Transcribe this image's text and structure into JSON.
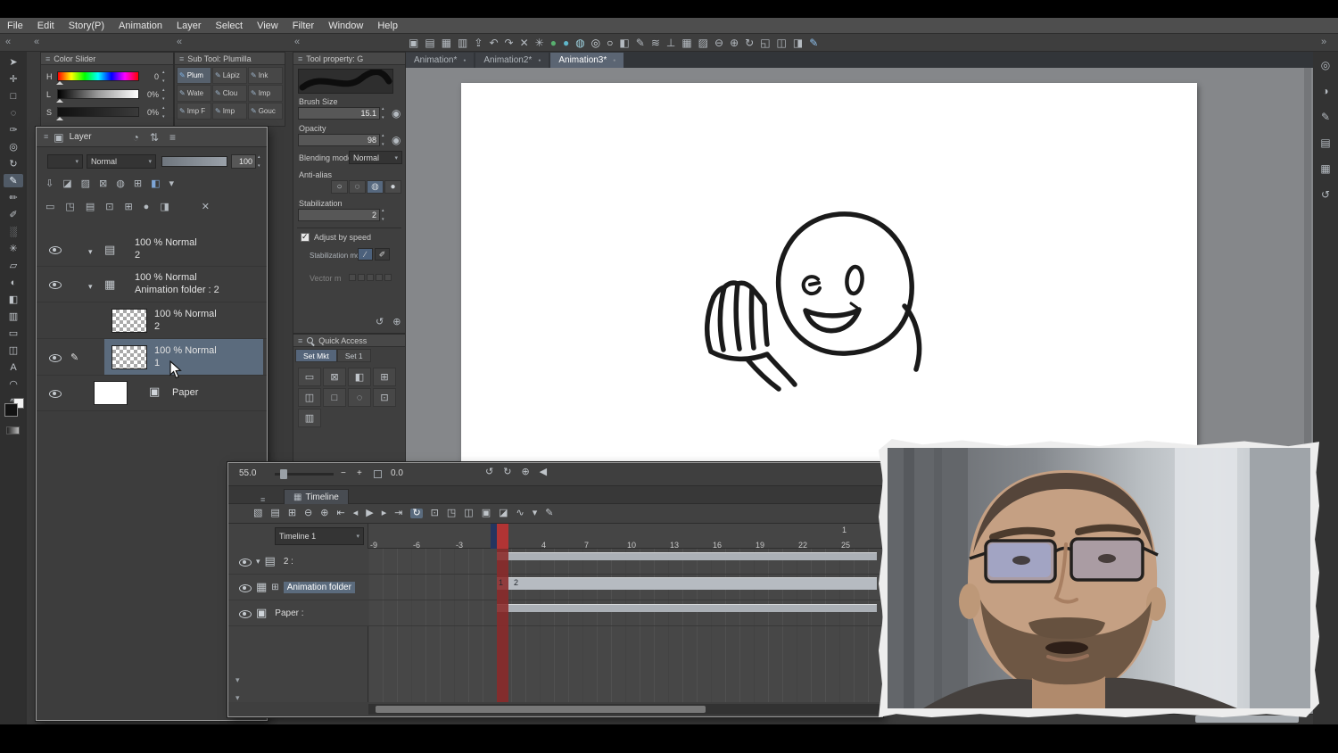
{
  "chrome": {
    "collapse_left": "«",
    "collapse_right": "»"
  },
  "menubar": {
    "items": [
      "File",
      "Edit",
      "Story(P)",
      "Animation",
      "Layer",
      "Select",
      "View",
      "Filter",
      "Window",
      "Help"
    ]
  },
  "main_toolbar": {
    "icons": [
      {
        "name": "workspace-icon",
        "glyph": "▣"
      },
      {
        "name": "open-icon",
        "glyph": "▤"
      },
      {
        "name": "save-icon",
        "glyph": "▦"
      },
      {
        "name": "print-icon",
        "glyph": "▥"
      },
      {
        "name": "export-icon",
        "glyph": "⇪"
      },
      {
        "name": "undo-icon",
        "glyph": "↶"
      },
      {
        "name": "redo-icon",
        "glyph": "↷"
      },
      {
        "name": "deselect-icon",
        "glyph": "✕"
      },
      {
        "name": "snap-icon",
        "glyph": "✳"
      },
      {
        "name": "onion-prev-icon",
        "glyph": "●",
        "color": "#58b06f"
      },
      {
        "name": "onion-next-icon",
        "glyph": "●",
        "color": "#5fb6c9"
      },
      {
        "name": "light-table-icon",
        "glyph": "◍",
        "color": "#9fd3e0"
      },
      {
        "name": "circle-state-icon",
        "glyph": "◎",
        "color": "#cfd6dc"
      },
      {
        "name": "white-circle-icon",
        "glyph": "○",
        "color": "#e8eef2"
      },
      {
        "name": "flip-view-icon",
        "glyph": "◧"
      },
      {
        "name": "pen-state-icon",
        "glyph": "✎"
      },
      {
        "name": "cloud-sync-icon",
        "glyph": "≋"
      },
      {
        "name": "snap-ruler-icon",
        "glyph": "⊥"
      },
      {
        "name": "grid-icon",
        "glyph": "▦"
      },
      {
        "name": "material-icon",
        "glyph": "▨"
      },
      {
        "name": "zoom-out-icon",
        "glyph": "⊖"
      },
      {
        "name": "zoom-in-icon",
        "glyph": "⊕"
      },
      {
        "name": "rotate-view-icon",
        "glyph": "↻"
      },
      {
        "name": "fit-view-icon",
        "glyph": "◱"
      },
      {
        "name": "layout-icon",
        "glyph": "◫"
      },
      {
        "name": "dual-pane-icon",
        "glyph": "◨"
      },
      {
        "name": "active-brush-icon",
        "glyph": "✎",
        "color": "#8fc1ee",
        "active": true
      }
    ]
  },
  "doc_tabs": [
    {
      "name": "tab-animation-1",
      "label": "Animation*"
    },
    {
      "name": "tab-animation-2",
      "label": "Animation2*"
    },
    {
      "name": "tab-animation-3",
      "label": "Animation3*",
      "active": true
    }
  ],
  "tool_strip": {
    "tools": [
      {
        "name": "operation-tool-icon",
        "glyph": "➤"
      },
      {
        "name": "move-tool-icon",
        "glyph": "✛"
      },
      {
        "name": "selection-tool-icon",
        "glyph": "□"
      },
      {
        "name": "auto-select-tool-icon",
        "glyph": "◌"
      },
      {
        "name": "eyedropper-tool-icon",
        "glyph": "✑"
      },
      {
        "name": "zoom-tool-icon",
        "glyph": "◎"
      },
      {
        "name": "rotate-tool-icon",
        "glyph": "↻"
      },
      {
        "name": "pen-tool-icon",
        "glyph": "✎",
        "active": true
      },
      {
        "name": "pencil-tool-icon",
        "glyph": "✏"
      },
      {
        "name": "brush-tool-icon",
        "glyph": "✐"
      },
      {
        "name": "airbrush-tool-icon",
        "glyph": "░"
      },
      {
        "name": "decoration-tool-icon",
        "glyph": "✳"
      },
      {
        "name": "eraser-tool-icon",
        "glyph": "▱"
      },
      {
        "name": "blend-tool-icon",
        "glyph": "◐"
      },
      {
        "name": "fill-tool-icon",
        "glyph": "◧"
      },
      {
        "name": "gradient-tool-icon",
        "glyph": "▥"
      },
      {
        "name": "figure-tool-icon",
        "glyph": "▭"
      },
      {
        "name": "frame-border-tool-icon",
        "glyph": "◫"
      },
      {
        "name": "text-tool-icon",
        "glyph": "A"
      },
      {
        "name": "balloon-tool-icon",
        "glyph": "◠"
      },
      {
        "name": "correct-line-tool-icon",
        "glyph": "∿"
      }
    ]
  },
  "panels": {
    "color_slider": {
      "title": "Color Slider",
      "rows": [
        {
          "label": "H",
          "value": "0"
        },
        {
          "label": "L",
          "value": "0%"
        },
        {
          "label": "S",
          "value": "0%"
        }
      ]
    },
    "sub_tool": {
      "title": "Sub Tool: Plumilla",
      "items": [
        {
          "name": "subtool-plumilla",
          "label": "Plum",
          "active": true
        },
        {
          "name": "subtool-lapiz",
          "label": "Lápiz"
        },
        {
          "name": "subtool-ink",
          "label": "Ink"
        },
        {
          "name": "subtool-watercolor",
          "label": "Wate"
        },
        {
          "name": "subtool-cloud",
          "label": "Clou"
        },
        {
          "name": "subtool-imp-1",
          "label": "Imp"
        },
        {
          "name": "subtool-imp-f",
          "label": "Imp F"
        },
        {
          "name": "subtool-imp-2",
          "label": "Imp"
        },
        {
          "name": "subtool-gouache",
          "label": "Gouc"
        }
      ]
    },
    "tool_property": {
      "title": "Tool property: G",
      "brush_size_label": "Brush Size",
      "brush_size_value": "15.1",
      "opacity_label": "Opacity",
      "opacity_value": "98",
      "blending_label": "Blending mode",
      "blending_value": "Normal",
      "anti_alias_label": "Anti-alias",
      "anti_alias_options": [
        {
          "name": "aa-none-icon",
          "glyph": "○"
        },
        {
          "name": "aa-weak-icon",
          "glyph": "◌"
        },
        {
          "name": "aa-medium-icon",
          "glyph": "◍",
          "active": true
        },
        {
          "name": "aa-strong-icon",
          "glyph": "●"
        }
      ],
      "stabilization_label": "Stabilization",
      "stabilization_value": "2",
      "adjust_by_speed_label": "Adjust by speed",
      "stabilization_mode_label": "Stabilization mod",
      "stab_mode_icons": [
        {
          "name": "stabilization-line-icon",
          "glyph": "∕",
          "active": true
        },
        {
          "name": "stabilization-brush-icon",
          "glyph": "✐"
        }
      ],
      "vector_label": "Vector m",
      "footer_icons": [
        {
          "name": "reset-tool-icon",
          "glyph": "↺"
        },
        {
          "name": "register-settings-icon",
          "glyph": "⊕"
        }
      ]
    },
    "quick_access": {
      "title": "Quick Access",
      "tabs": [
        {
          "name": "qa-tab-set-mkt",
          "label": "Set Mkt",
          "active": true
        },
        {
          "name": "qa-tab-set-1",
          "label": "Set 1"
        }
      ],
      "icons": [
        {
          "name": "qa-new-layer-icon",
          "glyph": "▭"
        },
        {
          "name": "qa-clear-icon",
          "glyph": "⊠"
        },
        {
          "name": "qa-fill-icon",
          "glyph": "◧"
        },
        {
          "name": "qa-transform-icon",
          "glyph": "⊞"
        },
        {
          "name": "qa-flip-icon",
          "glyph": "◫"
        },
        {
          "name": "qa-select-icon",
          "glyph": "□"
        },
        {
          "name": "qa-deselect-icon",
          "glyph": "◌"
        },
        {
          "name": "qa-copy-icon",
          "glyph": "⊡"
        },
        {
          "name": "qa-paste-icon",
          "glyph": "▥"
        }
      ]
    }
  },
  "layer_panel": {
    "title": "Layer",
    "header_icons": [
      {
        "name": "layer-search-icon",
        "glyph": "◔"
      },
      {
        "name": "layer-dock-icon",
        "glyph": "⇅"
      },
      {
        "name": "layer-menu-icon",
        "glyph": "≡"
      }
    ],
    "blend_mode_value": "Normal",
    "opacity_value": "100",
    "toolbar_a": [
      {
        "name": "blend-through-icon",
        "glyph": "⇩"
      },
      {
        "name": "clip-to-layer-icon",
        "glyph": "◪"
      },
      {
        "name": "lock-transparency-icon",
        "glyph": "▨"
      },
      {
        "name": "lock-layer-icon",
        "glyph": "⊠"
      },
      {
        "name": "enable-mask-icon",
        "glyph": "◍"
      },
      {
        "name": "ruler-icon",
        "glyph": "⊞"
      },
      {
        "name": "layer-color-icon",
        "glyph": "◧",
        "color": "#7ea6d8"
      },
      {
        "name": "layer-color-dropdown-icon",
        "glyph": "▾"
      }
    ],
    "toolbar_b": [
      {
        "name": "new-raster-layer-icon",
        "glyph": "▭"
      },
      {
        "name": "new-layer-dialog-icon",
        "glyph": "◳"
      },
      {
        "name": "new-folder-icon",
        "glyph": "▤"
      },
      {
        "name": "transfer-layer-icon",
        "glyph": "⊡"
      },
      {
        "name": "duplicate-layer-icon",
        "glyph": "⊞"
      },
      {
        "name": "merge-down-icon",
        "glyph": "●"
      },
      {
        "name": "create-mask-icon",
        "glyph": "◨"
      },
      {
        "name": "delete-layer-icon",
        "glyph": "✕"
      }
    ],
    "layers": [
      {
        "line1": "100 % Normal",
        "line2": "2"
      },
      {
        "line1": "100 % Normal",
        "line2": "Animation folder : 2"
      },
      {
        "line1": "100 % Normal",
        "line2": "2"
      },
      {
        "line1": "100 % Normal",
        "line2": "1",
        "selected": true
      },
      {
        "line1": "Paper"
      }
    ]
  },
  "timeline": {
    "zoom_value": "55.0",
    "zoom_minus": "−",
    "zoom_plus": "+",
    "time_value": "0.0",
    "header_icons": [
      {
        "name": "undo-icon",
        "glyph": "↺"
      },
      {
        "name": "redo-icon",
        "glyph": "↻"
      },
      {
        "name": "add-keyframe-icon",
        "glyph": "⊕"
      },
      {
        "name": "collapse-icon",
        "glyph": "◀"
      }
    ],
    "tab_label": "Timeline",
    "toolbar_icons": [
      {
        "name": "timeline-menu-icon",
        "glyph": "▧"
      },
      {
        "name": "onion-skin-icon",
        "glyph": "▤"
      },
      {
        "name": "onion-settings-icon",
        "glyph": "⊞"
      },
      {
        "name": "zoom-out-icon",
        "glyph": "⊖"
      },
      {
        "name": "zoom-in-icon",
        "glyph": "⊕"
      },
      {
        "name": "go-first-frame-icon",
        "glyph": "⇤"
      },
      {
        "name": "prev-frame-icon",
        "glyph": "◂"
      },
      {
        "name": "play-icon",
        "glyph": "▶"
      },
      {
        "name": "next-frame-icon",
        "glyph": "▸"
      },
      {
        "name": "go-last-frame-icon",
        "glyph": "⇥"
      },
      {
        "name": "loop-playback-icon",
        "glyph": "↻",
        "active": true
      },
      {
        "name": "new-animation-cel-icon",
        "glyph": "⊡"
      },
      {
        "name": "specify-cel-icon",
        "glyph": "◳"
      },
      {
        "name": "new-timeline-icon",
        "glyph": "◫"
      },
      {
        "name": "batch-cel-icon",
        "glyph": "▣"
      },
      {
        "name": "onion-color-icon",
        "glyph": "◪"
      },
      {
        "name": "track-edit-icon",
        "glyph": "∿"
      },
      {
        "name": "normal-mode-icon",
        "glyph": "▾"
      },
      {
        "name": "cel-pen-icon",
        "glyph": "✎"
      }
    ],
    "selector_value": "Timeline 1",
    "ruler_numbers": [
      "-9",
      "-6",
      "-3",
      "1",
      "4",
      "7",
      "10",
      "13",
      "16",
      "19",
      "22",
      "25"
    ],
    "second_marker": "1",
    "cel_labels": [
      "1",
      "2"
    ],
    "tracks": [
      {
        "name": "2 :"
      },
      {
        "name": "Animation folder",
        "selected": true
      },
      {
        "name": "Paper :"
      }
    ]
  },
  "right_strip": {
    "icons": [
      {
        "name": "navigator-icon",
        "glyph": "◎"
      },
      {
        "name": "subview-icon",
        "glyph": "◑"
      },
      {
        "name": "brush-size-panel-icon",
        "glyph": "✎"
      },
      {
        "name": "color-set-icon",
        "glyph": "▤"
      },
      {
        "name": "material-panel-icon",
        "glyph": "▦"
      },
      {
        "name": "history-icon",
        "glyph": "↺"
      }
    ]
  }
}
